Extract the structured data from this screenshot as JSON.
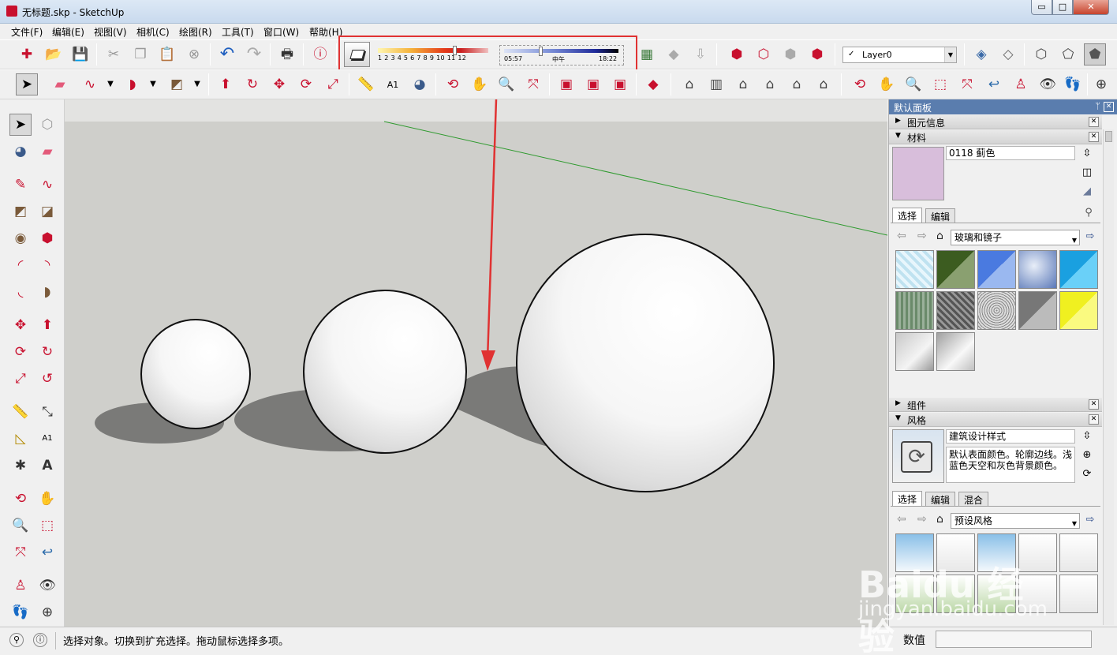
{
  "window": {
    "title": "无标题.skp - SketchUp",
    "min_label": "▭",
    "max_label": "□",
    "close_label": "✕"
  },
  "menu": [
    "文件(F)",
    "编辑(E)",
    "视图(V)",
    "相机(C)",
    "绘图(R)",
    "工具(T)",
    "窗口(W)",
    "帮助(H)"
  ],
  "shadows": {
    "month_labels": "1  2  3  4  5  6  7  8  9  10 11 12",
    "month_value": 9,
    "time_start": "05:57",
    "time_middle": "中午",
    "time_end": "18:22"
  },
  "layer": {
    "checked": "✓",
    "value": "Layer0"
  },
  "tray": {
    "title": "默认面板",
    "pin_icon": "ᛘ",
    "close": "✕",
    "entity_info": {
      "label": "图元信息"
    },
    "materials": {
      "label": "材料",
      "name": "0118 蓟色",
      "swatch_color": "#d8bedb",
      "tabs": [
        "选择",
        "编辑"
      ],
      "collection": "玻璃和镜子"
    },
    "components": {
      "label": "组件"
    },
    "styles": {
      "label": "风格",
      "name": "建筑设计样式",
      "description": "默认表面颜色。轮廓边线。浅蓝色天空和灰色背景颜色。",
      "tabs": [
        "选择",
        "编辑",
        "混合"
      ],
      "collection": "预设风格"
    }
  },
  "status": {
    "message": "选择对象。切换到扩充选择。拖动鼠标选择多项。",
    "vcb_label": "数值"
  },
  "watermark": {
    "line1": "Baidu 经验",
    "line2": "jingyan.baidu.com"
  },
  "colors": {
    "highlight_red": "#e03232",
    "tray_title_blue": "#5a7dae",
    "viewport_ground": "#cfcfcb",
    "sky": "#e3e3e1"
  }
}
